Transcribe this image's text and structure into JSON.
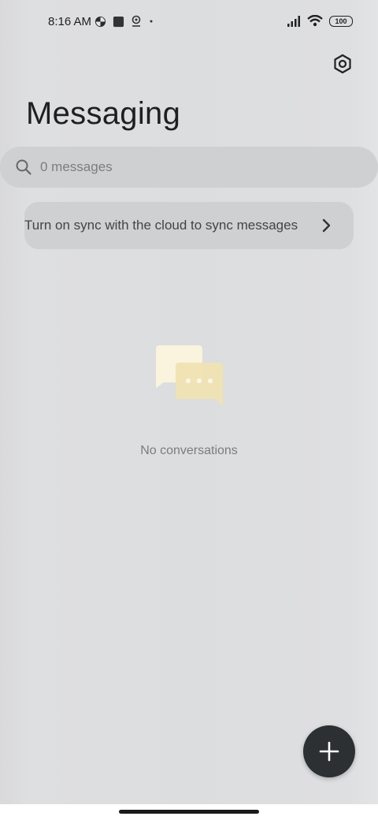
{
  "status_bar": {
    "time": "8:16 AM",
    "battery": "100",
    "icons_left": [
      "pinwheel-icon",
      "square-icon",
      "location-pin-icon",
      "dot-icon"
    ],
    "icons_right": [
      "signal-icon",
      "wifi-icon",
      "battery-icon"
    ]
  },
  "header": {
    "title": "Messaging",
    "settings_icon": "gear-icon"
  },
  "search": {
    "placeholder": "0 messages",
    "icon": "search-icon"
  },
  "sync_banner": {
    "text": "Turn on sync with the cloud to sync messages",
    "icon": "chevron-right-icon"
  },
  "empty_state": {
    "label": "No conversations",
    "icon": "chat-bubbles-icon"
  },
  "fab": {
    "icon": "plus-icon"
  },
  "colors": {
    "background": "#dcdddf",
    "surface": "#cfd0d2",
    "fab": "#2d3033",
    "bubble_front": "#f0e2b0",
    "bubble_back": "#faf3de"
  }
}
